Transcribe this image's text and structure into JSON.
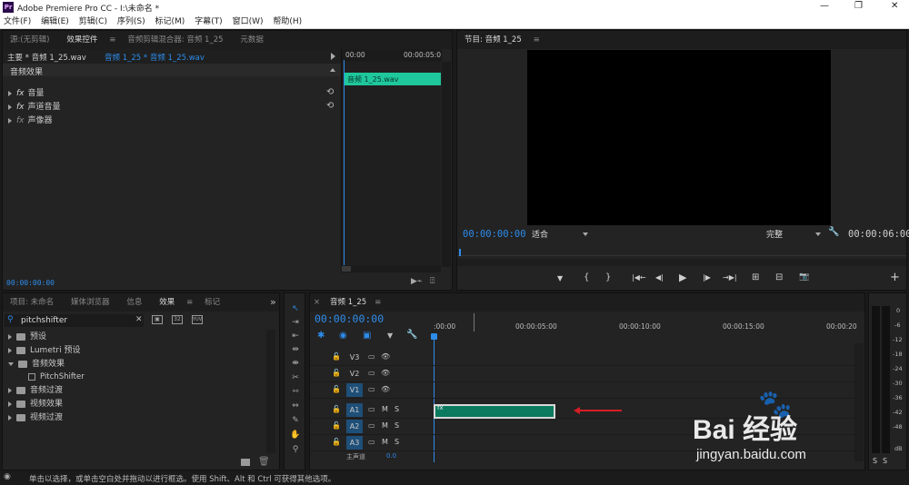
{
  "app": {
    "title": "Adobe Premiere Pro CC - I:\\未命名 *",
    "logo": "Pr"
  },
  "window_controls": [
    "—",
    "❐",
    "✕"
  ],
  "menu": [
    "文件(F)",
    "编辑(E)",
    "剪辑(C)",
    "序列(S)",
    "标记(M)",
    "字幕(T)",
    "窗口(W)",
    "帮助(H)"
  ],
  "source_panel": {
    "tabs": [
      "源:(无剪辑)",
      "效果控件",
      "音频剪辑混合器: 音频 1_25",
      "元数据"
    ],
    "tab_menu": "≡",
    "master_label": "主要 * 音频 1_25.wav",
    "sequence_label": "音频 1_25 * 音频 1_25.wav",
    "ruler": [
      "00:00",
      "00:00:05:0"
    ],
    "section_header": "音频效果",
    "clip_name": "音频 1_25.wav",
    "effects": [
      {
        "fx": "fx",
        "name": "音量"
      },
      {
        "fx": "fx",
        "name": "声道音量"
      },
      {
        "fx": "fx",
        "name": "声像器"
      }
    ],
    "timecode": "00:00:00:00"
  },
  "program_panel": {
    "title": "节目: 音频 1_25",
    "tab_menu": "≡",
    "timecode_left": "00:00:00:00",
    "fit": "适合",
    "quality": "完整",
    "timecode_right": "00:00:06:00",
    "controls": [
      "▼",
      "{",
      "}",
      "|◀←",
      "◀|",
      "▶",
      "|▶",
      "→▶|",
      "⊞",
      "⊟",
      "📷",
      "+"
    ]
  },
  "project_panel": {
    "tabs": [
      "项目: 未命名",
      "媒体浏览器",
      "信息",
      "效果",
      "标记"
    ],
    "active_tab": "效果",
    "tab_menu": "≡",
    "overflow": "»",
    "search_value": "pitchshifter",
    "clear": "✕",
    "tree": [
      {
        "label": "预设",
        "open": false,
        "level": 0
      },
      {
        "label": "Lumetri 预设",
        "open": false,
        "level": 0
      },
      {
        "label": "音频效果",
        "open": true,
        "level": 0
      },
      {
        "label": "PitchShifter",
        "open": false,
        "level": 1
      },
      {
        "label": "音频过渡",
        "open": false,
        "level": 0
      },
      {
        "label": "视频效果",
        "open": false,
        "level": 0
      },
      {
        "label": "视频过渡",
        "open": false,
        "level": 0
      }
    ]
  },
  "timeline": {
    "tab_close": "×",
    "sequence": "音频 1_25",
    "tab_menu": "≡",
    "timecode": "00:00:00:00",
    "ruler": [
      ":00:00",
      "00:00:05:00",
      "00:00:10:00",
      "00:00:15:00",
      "00:00:20"
    ],
    "tracks": [
      {
        "name": "V3",
        "highlight": false,
        "m": "",
        "s": ""
      },
      {
        "name": "V2",
        "highlight": false,
        "m": "",
        "s": ""
      },
      {
        "name": "V1",
        "highlight": true,
        "m": "",
        "s": ""
      },
      {
        "name": "A1",
        "highlight": true,
        "m": "M",
        "s": "S"
      },
      {
        "name": "A2",
        "highlight": true,
        "m": "M",
        "s": "S"
      },
      {
        "name": "A3",
        "highlight": true,
        "m": "M",
        "s": "S"
      }
    ],
    "master_label": "主声道",
    "master_value": "0.0",
    "clip_fx": "fx"
  },
  "audio_meter": {
    "scale": [
      "0",
      "-6",
      "-12",
      "-18",
      "-24",
      "-30",
      "-36",
      "-42",
      "-48",
      "dB"
    ],
    "solo": [
      "S",
      "S"
    ]
  },
  "status_bar": {
    "text": "单击以选择，或单击空白处并拖动以进行框选。使用 Shift、Alt 和 Ctrl 可获得其他选项。"
  },
  "watermark": {
    "brand": "Bai 经验",
    "url": "jingyan.baidu.com"
  },
  "colors": {
    "accent": "#2d8ceb",
    "audio_clip": "#0b7a5e",
    "clip_label": "#19c597",
    "track_highlight": "#1e4f78",
    "arrow": "#d61e24"
  }
}
